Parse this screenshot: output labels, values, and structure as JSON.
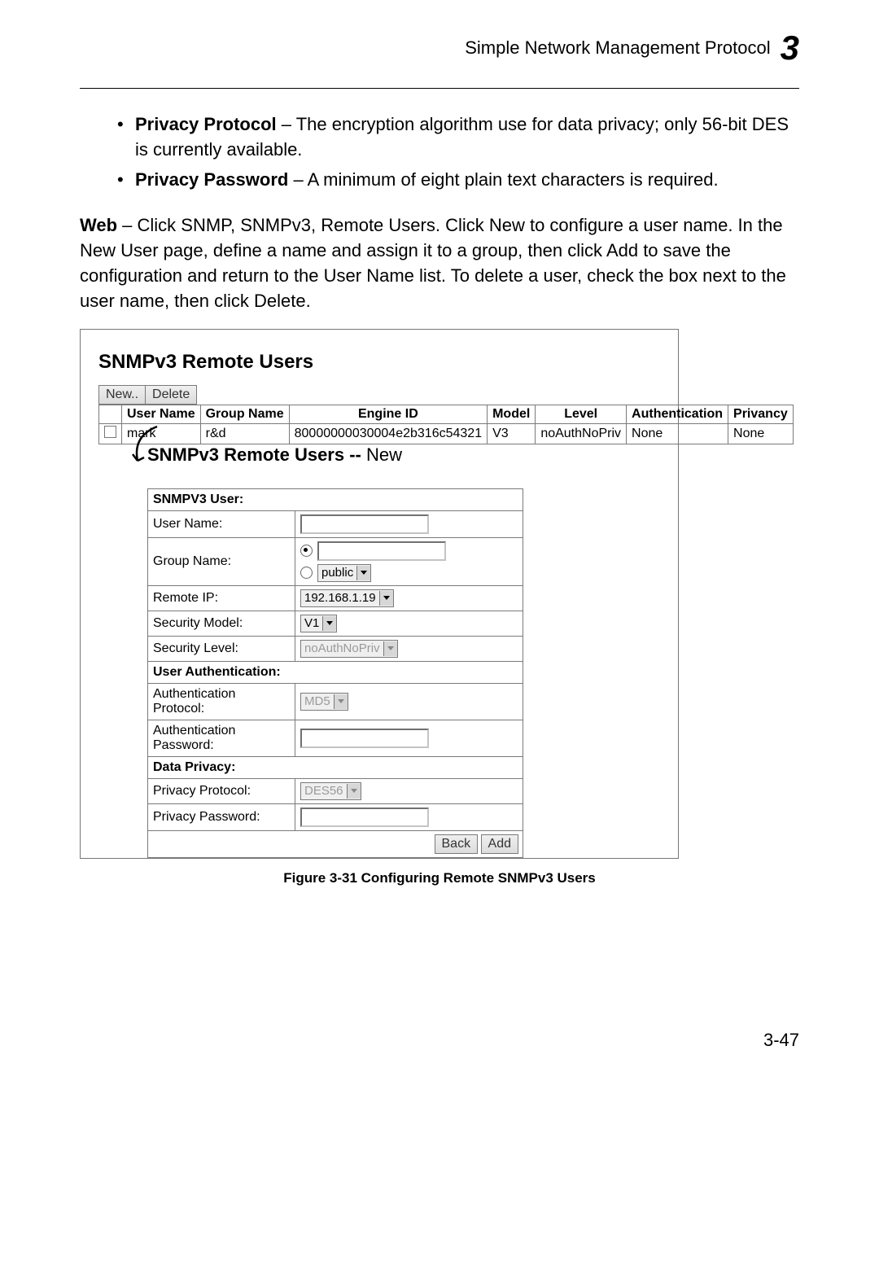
{
  "header": {
    "title": "Simple Network Management Protocol",
    "chapter": "3"
  },
  "bullets": [
    {
      "term": "Privacy Protocol",
      "desc": " – The encryption algorithm use for data privacy; only 56-bit DES is currently available."
    },
    {
      "term": "Privacy Password",
      "desc": " – A minimum of eight plain text characters is required."
    }
  ],
  "web_para": {
    "lead": "Web",
    "body": " – Click SNMP, SNMPv3, Remote Users. Click New to configure a user name. In the New User page, define a name and assign it to a group, then click Add to save the configuration and return to the User Name list. To delete a user, check the box next to the user name, then click Delete."
  },
  "shot1": {
    "title": "SNMPv3 Remote Users",
    "btn_new": "New..",
    "btn_del": "Delete",
    "cols": [
      "User Name",
      "Group Name",
      "Engine ID",
      "Model",
      "Level",
      "Authentication",
      "Privancy"
    ],
    "row": {
      "user": "mark",
      "group": "r&d",
      "engine": "80000000030004e2b316c54321",
      "model": "V3",
      "level": "noAuthNoPriv",
      "auth": "None",
      "priv": "None"
    }
  },
  "shot2": {
    "title_main": "SNMPv3 Remote Users --",
    "title_sub": " New",
    "sect_user": "SNMPV3 User:",
    "lbl_username": "User Name:",
    "lbl_group": "Group Name:",
    "grp_select": "public",
    "lbl_remoteip": "Remote IP:",
    "remoteip": "192.168.1.19",
    "lbl_secmodel": "Security Model:",
    "secmodel": "V1",
    "lbl_seclevel": "Security Level:",
    "seclevel": "noAuthNoPriv",
    "sect_auth": "User Authentication:",
    "lbl_authproto": "Authentication Protocol:",
    "authproto": "MD5",
    "lbl_authpass": "Authentication Password:",
    "sect_priv": "Data Privacy:",
    "lbl_privproto": "Privacy Protocol:",
    "privproto": "DES56",
    "lbl_privpass": "Privacy Password:",
    "btn_back": "Back",
    "btn_add": "Add"
  },
  "caption": "Figure 3-31   Configuring Remote SNMPv3 Users",
  "pagenum": "3-47"
}
